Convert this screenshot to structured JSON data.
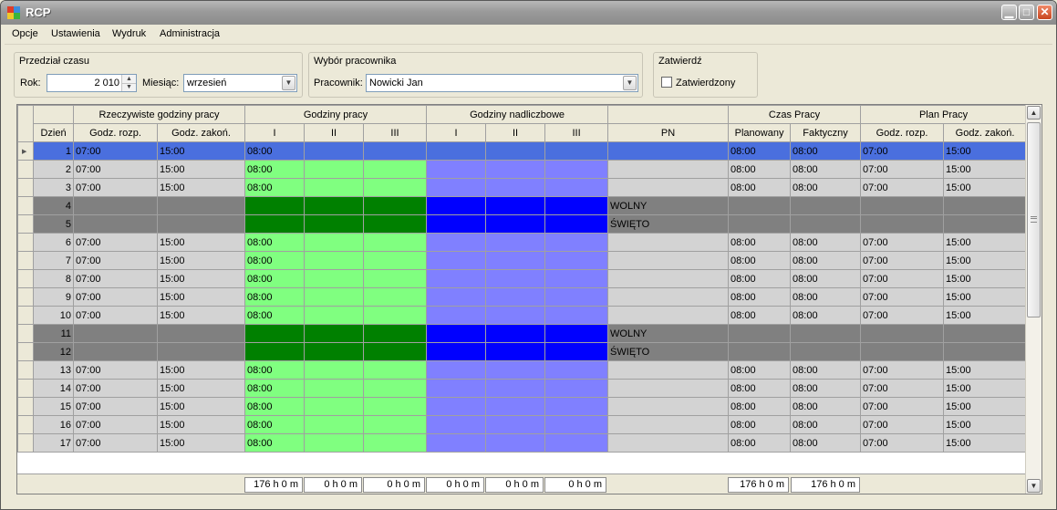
{
  "window": {
    "title": "RCP"
  },
  "menu": [
    "Opcje",
    "Ustawienia",
    "Wydruk",
    "Administracja"
  ],
  "filters": {
    "period": {
      "title": "Przedział czasu",
      "year_label": "Rok:",
      "year_value": "2 010",
      "month_label": "Miesiąc:",
      "month_value": "wrzesień"
    },
    "employee": {
      "title": "Wybór pracownika",
      "label": "Pracownik:",
      "value": "Nowicki Jan"
    },
    "approve": {
      "title": "Zatwierdź",
      "checkbox_label": "Zatwierdzony",
      "checked": false
    }
  },
  "grid": {
    "group_headers": [
      "Rzeczywiste godziny pracy",
      "Godziny pracy",
      "Godziny nadliczbowe",
      "Czas Pracy",
      "Plan Pracy"
    ],
    "columns": [
      "Dzień",
      "Godz. rozp.",
      "Godz. zakoń.",
      "I",
      "II",
      "III",
      "I",
      "II",
      "III",
      "PN",
      "Planowany",
      "Faktyczny",
      "Godz. rozp.",
      "Godz. zakoń."
    ],
    "colors": {
      "selected": "#4a6fde",
      "gray": "#d3d3d3",
      "green": "#80ff80",
      "blue_light": "#8080ff",
      "dark_gray": "#808080",
      "dark_green": "#008000",
      "dark_blue": "#0000ff"
    },
    "rows": [
      {
        "day": "1",
        "type": "selected",
        "cells": [
          "07:00",
          "15:00",
          "08:00",
          "",
          "",
          "",
          "",
          "",
          "",
          "08:00",
          "08:00",
          "07:00",
          "15:00"
        ]
      },
      {
        "day": "2",
        "type": "work",
        "cells": [
          "07:00",
          "15:00",
          "08:00",
          "",
          "",
          "",
          "",
          "",
          "",
          "08:00",
          "08:00",
          "07:00",
          "15:00"
        ]
      },
      {
        "day": "3",
        "type": "work",
        "cells": [
          "07:00",
          "15:00",
          "08:00",
          "",
          "",
          "",
          "",
          "",
          "",
          "08:00",
          "08:00",
          "07:00",
          "15:00"
        ]
      },
      {
        "day": "4",
        "type": "off",
        "cells": [
          "",
          "",
          "",
          "",
          "",
          "",
          "",
          "",
          "WOLNY",
          "",
          "",
          "",
          ""
        ]
      },
      {
        "day": "5",
        "type": "off",
        "cells": [
          "",
          "",
          "",
          "",
          "",
          "",
          "",
          "",
          "ŚWIĘTO",
          "",
          "",
          "",
          ""
        ]
      },
      {
        "day": "6",
        "type": "work",
        "cells": [
          "07:00",
          "15:00",
          "08:00",
          "",
          "",
          "",
          "",
          "",
          "",
          "08:00",
          "08:00",
          "07:00",
          "15:00"
        ]
      },
      {
        "day": "7",
        "type": "work",
        "cells": [
          "07:00",
          "15:00",
          "08:00",
          "",
          "",
          "",
          "",
          "",
          "",
          "08:00",
          "08:00",
          "07:00",
          "15:00"
        ]
      },
      {
        "day": "8",
        "type": "work",
        "cells": [
          "07:00",
          "15:00",
          "08:00",
          "",
          "",
          "",
          "",
          "",
          "",
          "08:00",
          "08:00",
          "07:00",
          "15:00"
        ]
      },
      {
        "day": "9",
        "type": "work",
        "cells": [
          "07:00",
          "15:00",
          "08:00",
          "",
          "",
          "",
          "",
          "",
          "",
          "08:00",
          "08:00",
          "07:00",
          "15:00"
        ]
      },
      {
        "day": "10",
        "type": "work",
        "cells": [
          "07:00",
          "15:00",
          "08:00",
          "",
          "",
          "",
          "",
          "",
          "",
          "08:00",
          "08:00",
          "07:00",
          "15:00"
        ]
      },
      {
        "day": "11",
        "type": "off",
        "cells": [
          "",
          "",
          "",
          "",
          "",
          "",
          "",
          "",
          "WOLNY",
          "",
          "",
          "",
          ""
        ]
      },
      {
        "day": "12",
        "type": "off",
        "cells": [
          "",
          "",
          "",
          "",
          "",
          "",
          "",
          "",
          "ŚWIĘTO",
          "",
          "",
          "",
          ""
        ]
      },
      {
        "day": "13",
        "type": "work",
        "cells": [
          "07:00",
          "15:00",
          "08:00",
          "",
          "",
          "",
          "",
          "",
          "",
          "08:00",
          "08:00",
          "07:00",
          "15:00"
        ]
      },
      {
        "day": "14",
        "type": "work",
        "cells": [
          "07:00",
          "15:00",
          "08:00",
          "",
          "",
          "",
          "",
          "",
          "",
          "08:00",
          "08:00",
          "07:00",
          "15:00"
        ]
      },
      {
        "day": "15",
        "type": "work",
        "cells": [
          "07:00",
          "15:00",
          "08:00",
          "",
          "",
          "",
          "",
          "",
          "",
          "08:00",
          "08:00",
          "07:00",
          "15:00"
        ]
      },
      {
        "day": "16",
        "type": "work",
        "cells": [
          "07:00",
          "15:00",
          "08:00",
          "",
          "",
          "",
          "",
          "",
          "",
          "08:00",
          "08:00",
          "07:00",
          "15:00"
        ]
      },
      {
        "day": "17",
        "type": "work",
        "cells": [
          "07:00",
          "15:00",
          "08:00",
          "",
          "",
          "",
          "",
          "",
          "",
          "08:00",
          "08:00",
          "07:00",
          "15:00"
        ]
      }
    ],
    "totals": {
      "hours_I": "176 h 0 m",
      "hours_II": "0 h 0 m",
      "hours_III": "0 h 0 m",
      "over_I": "0 h 0 m",
      "over_II": "0 h 0 m",
      "over_III": "0 h 0 m",
      "planned": "176 h 0 m",
      "actual": "176 h 0 m"
    }
  }
}
